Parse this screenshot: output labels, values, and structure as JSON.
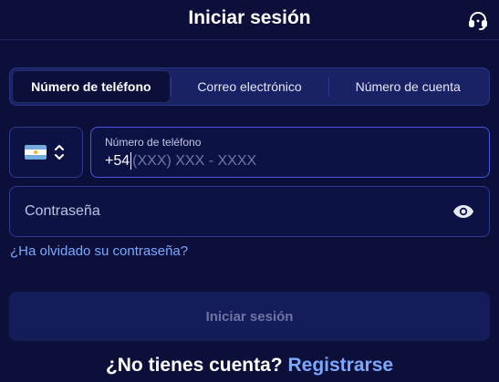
{
  "header": {
    "title": "Iniciar sesión",
    "support_icon": "headset-icon"
  },
  "tabs": [
    {
      "label": "Número de teléfono",
      "active": true
    },
    {
      "label": "Correo electrónico",
      "active": false
    },
    {
      "label": "Número de cuenta",
      "active": false
    }
  ],
  "country_selector": {
    "flag": "argentina-flag",
    "icon": "chevron-up-down-icon"
  },
  "phone": {
    "label": "Número de teléfono",
    "prefix": "+54",
    "placeholder": "(XXX) XXX - XXXX",
    "value": ""
  },
  "password": {
    "placeholder": "Contraseña",
    "value": "",
    "icon": "eye-icon"
  },
  "forgot_password": "¿Ha olvidado su contraseña?",
  "login_button": "Iniciar sesión",
  "signup": {
    "question": "¿No tienes cuenta?",
    "link": "Registrarse"
  },
  "colors": {
    "background": "#0b0f3a",
    "accent": "#7aa9ff",
    "active_border": "#4a57d8"
  }
}
